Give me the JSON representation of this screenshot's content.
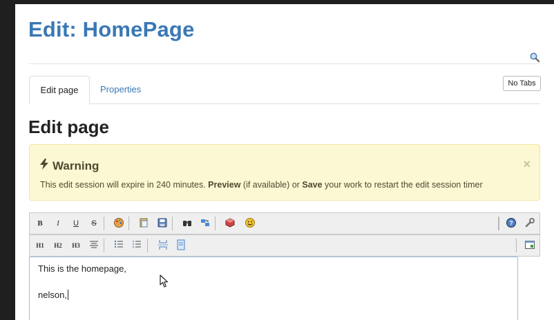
{
  "header": {
    "title": "Edit: HomePage"
  },
  "tabs": [
    {
      "label": "Edit page",
      "active": true
    },
    {
      "label": "Properties",
      "active": false
    }
  ],
  "no_tabs_label": "No Tabs",
  "section_title": "Edit page",
  "warning": {
    "title": "Warning",
    "text_prefix": "This edit session will expire in 240 minutes. ",
    "preview": "Preview",
    "text_mid": " (if available) or ",
    "save": "Save",
    "text_suffix": " your work to restart the edit session timer",
    "close": "×"
  },
  "toolbar_row1": {
    "bold": "B",
    "italic": "I",
    "underline": "U",
    "strike": "S"
  },
  "toolbar_row2": {
    "h1": "H1",
    "h2": "H2",
    "h3": "H3"
  },
  "editor": {
    "line1": "This is the homepage,",
    "line2": "nelson,"
  },
  "icons": {
    "search": "search-icon",
    "color": "color-palette-icon",
    "paste": "paste-icon",
    "save": "save-icon",
    "find": "binoculars-icon",
    "replace": "find-replace-icon",
    "plugin": "box-icon",
    "smiley": "smiley-icon",
    "help": "help-icon",
    "settings": "wrench-icon"
  },
  "colors": {
    "accent": "#3a78b5",
    "warning_bg": "#fcf8d3"
  }
}
